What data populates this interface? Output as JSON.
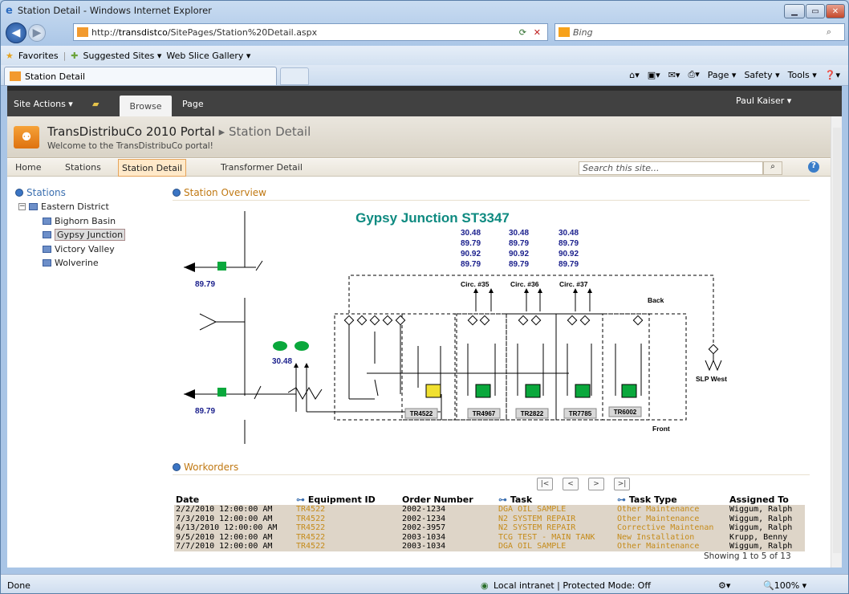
{
  "window": {
    "title": "Station Detail - Windows Internet Explorer"
  },
  "browser": {
    "url_prefix": "http://",
    "url_host": "transdistco",
    "url_path": "/SitePages/Station%20Detail.aspx",
    "search_engine": "Bing",
    "favorites": "Favorites",
    "suggested_sites": "Suggested Sites ▾",
    "web_slice": "Web Slice Gallery ▾",
    "tab_label": "Station Detail",
    "cmd": {
      "page": "Page ▾",
      "safety": "Safety ▾",
      "tools": "Tools ▾",
      "help": "❓▾"
    }
  },
  "ribbon": {
    "site_actions": "Site Actions ▾",
    "browse": "Browse",
    "page": "Page",
    "user": "Paul Kaiser ▾"
  },
  "site": {
    "title": "TransDistribuCo 2010 Portal",
    "breadcrumb_sep": "▸",
    "breadcrumb_current": "Station Detail",
    "welcome": "Welcome to the TransDistribuCo portal!",
    "search_placeholder": "Search this site..."
  },
  "topnav": [
    "Home",
    "Stations",
    "Station Detail",
    "Transformer Detail"
  ],
  "quicklaunch": {
    "heading": "Stations",
    "district": "Eastern District",
    "stations": [
      "Bighorn Basin",
      "Gypsy Junction",
      "Victory Valley",
      "Wolverine"
    ]
  },
  "overview": {
    "heading": "Station Overview",
    "title": "Gypsy Junction ST3347",
    "readings": [
      [
        "30.48",
        "30.48",
        "30.48"
      ],
      [
        "89.79",
        "89.79",
        "89.79"
      ],
      [
        "90.92",
        "90.92",
        "90.92"
      ],
      [
        "89.79",
        "89.79",
        "89.79"
      ]
    ],
    "circuits": [
      "Circ. #35",
      "Circ. #36",
      "Circ. #37"
    ],
    "left_top_value": "89.79",
    "left_mid_value": "30.48",
    "left_bottom_value": "89.79",
    "back_label": "Back",
    "front_label": "Front",
    "slp_label": "SLP West",
    "transformers": [
      "TR4522",
      "TR4967",
      "TR2822",
      "TR7785",
      "TR6002"
    ]
  },
  "workorders": {
    "heading": "Workorders",
    "columns": [
      "Date",
      "Equipment ID",
      "Order Number",
      "Task",
      "Task Type",
      "Assigned To"
    ],
    "rows": [
      [
        "2/2/2010 12:00:00 AM",
        "TR4522",
        "2002-1234",
        "DGA OIL SAMPLE",
        "Other Maintenance",
        "Wiggum, Ralph"
      ],
      [
        "7/3/2010 12:00:00 AM",
        "TR4522",
        "2002-1234",
        "N2 SYSTEM REPAIR",
        "Other Maintenance",
        "Wiggum, Ralph"
      ],
      [
        "4/13/2010 12:00:00 AM",
        "TR4522",
        "2002-3957",
        "N2 SYSTEM REPAIR",
        "Corrective Maintenan",
        "Wiggum, Ralph"
      ],
      [
        "9/5/2010 12:00:00 AM",
        "TR4522",
        "2003-1034",
        "TCG TEST - MAIN TANK",
        "New Installation",
        "Krupp, Benny"
      ],
      [
        "7/7/2010 12:00:00 AM",
        "TR4522",
        "2003-1034",
        "DGA OIL SAMPLE",
        "Other Maintenance",
        "Wiggum, Ralph"
      ]
    ],
    "pager": [
      "|<",
      "<",
      ">",
      ">|"
    ],
    "showing": "Showing 1 to 5 of 13"
  },
  "status": {
    "left": "Done",
    "zone": "Local intranet | Protected Mode: Off",
    "zoom": "🔍100% ▾"
  },
  "colors": {
    "accent_orange": "#c07812",
    "diagram_blue": "#1a1f8c",
    "diagram_title": "#0e8a80",
    "green": "#0aa83c",
    "yellow": "#f0e030"
  }
}
